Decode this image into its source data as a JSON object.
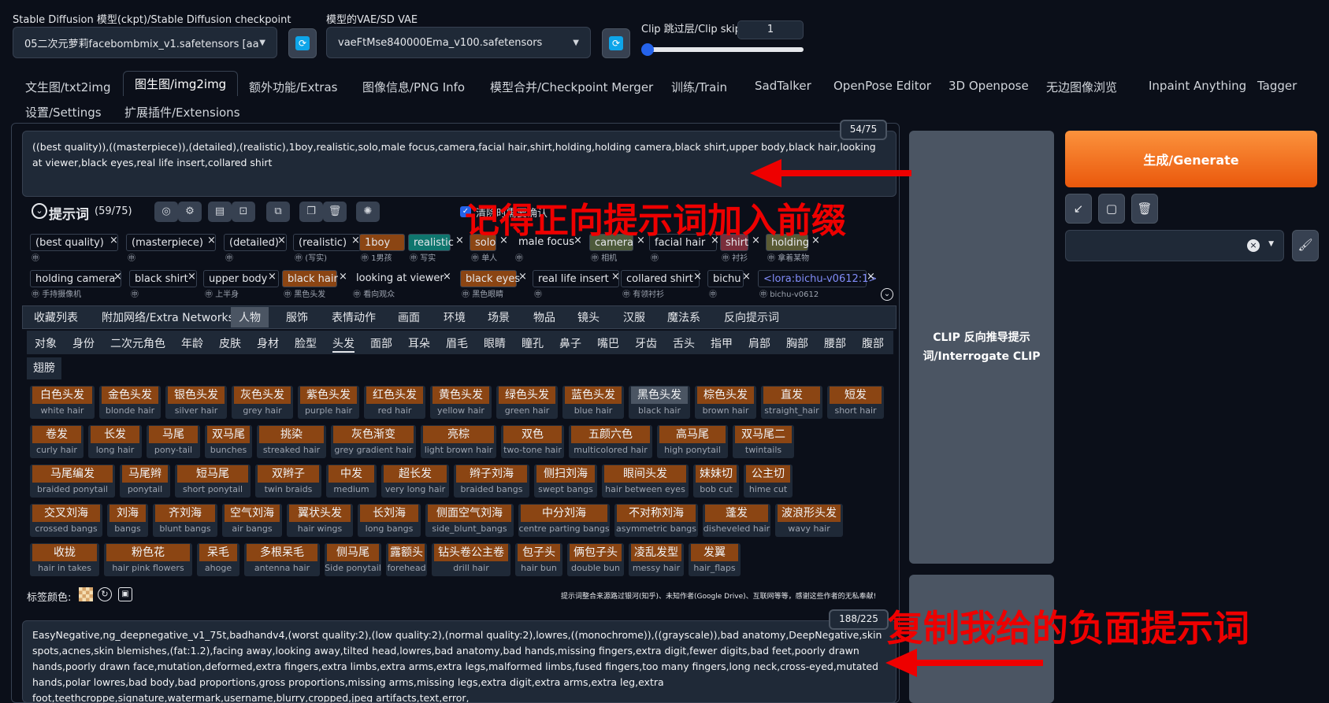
{
  "top": {
    "ckpt_label": "Stable Diffusion 模型(ckpt)/Stable Diffusion checkpoint",
    "ckpt_value": "05二次元萝莉facebombmix_v1.safetensors [aa",
    "vae_label": "模型的VAE/SD VAE",
    "vae_value": "vaeFtMse840000Ema_v100.safetensors",
    "clip_label": "Clip 跳过层/Clip skip",
    "clip_value": "1",
    "slider_fraction": 0.0
  },
  "tabs": [
    "文生图/txt2img",
    "图生图/img2img",
    "额外功能/Extras",
    "图像信息/PNG Info",
    "模型合并/Checkpoint Merger",
    "训练/Train",
    "SadTalker",
    "OpenPose Editor",
    "3D Openpose",
    "无边图像浏览",
    "Inpaint Anything",
    "Tagger",
    "设置/Settings",
    "扩展插件/Extensions"
  ],
  "prompt": {
    "counter": "54/75",
    "text": "((best quality)),((masterpiece)),(detailed),(realistic),1boy,realistic,solo,male focus,camera,facial hair,shirt,holding,holding camera,black shirt,upper body,black hair,looking at viewer,black eyes,real life insert,collared shirt",
    "helper_title": "提示词",
    "helper_count": "(59/75)",
    "checkbox_label": "清除时需要确认"
  },
  "chips_row1": [
    {
      "t": "(best quality)",
      "s": ""
    },
    {
      "t": "(masterpiece)",
      "s": ""
    },
    {
      "t": "(detailed)",
      "s": ""
    },
    {
      "t": "(realistic)",
      "s": "(写实)"
    },
    {
      "t": "1boy",
      "s": "1男孩"
    },
    {
      "t": "realistic",
      "s": "写实"
    },
    {
      "t": "solo",
      "s": "单人"
    },
    {
      "t": "male focus",
      "s": ""
    },
    {
      "t": "camera",
      "s": "相机"
    },
    {
      "t": "facial hair",
      "s": ""
    },
    {
      "t": "shirt",
      "s": "衬衫"
    },
    {
      "t": "holding",
      "s": "拿着某物"
    }
  ],
  "chips_row2": [
    {
      "t": "holding camera",
      "s": "手持摄像机"
    },
    {
      "t": "black shirt",
      "s": ""
    },
    {
      "t": "upper body",
      "s": "上半身"
    },
    {
      "t": "black hair",
      "s": "黑色头发"
    },
    {
      "t": "looking at viewer",
      "s": "看向观众"
    },
    {
      "t": "black eyes",
      "s": "黑色眼睛"
    },
    {
      "t": "real life insert",
      "s": ""
    },
    {
      "t": "collared shirt",
      "s": "有领衬衫"
    },
    {
      "t": "bichu",
      "s": ""
    },
    {
      "t": "<lora:bichu-v0612:1>",
      "s": "bichu-v0612"
    }
  ],
  "categories": [
    "收藏列表",
    "附加网络/Extra Networks",
    "人物",
    "服饰",
    "表情动作",
    "画面",
    "环境",
    "场景",
    "物品",
    "镜头",
    "汉服",
    "魔法系",
    "反向提示词"
  ],
  "subcategories": [
    "对象",
    "身份",
    "二次元角色",
    "年龄",
    "皮肤",
    "身材",
    "脸型",
    "头发",
    "面部",
    "耳朵",
    "眉毛",
    "眼睛",
    "瞳孔",
    "鼻子",
    "嘴巴",
    "牙齿",
    "舌头",
    "指甲",
    "肩部",
    "胸部",
    "腰部",
    "腹部",
    "翅膀"
  ],
  "tag_rows": [
    [
      [
        "白色头发",
        "white hair"
      ],
      [
        "金色头发",
        "blonde hair"
      ],
      [
        "银色头发",
        "silver hair"
      ],
      [
        "灰色头发",
        "grey hair"
      ],
      [
        "紫色头发",
        "purple hair"
      ],
      [
        "红色头发",
        "red hair"
      ],
      [
        "黄色头发",
        "yellow hair"
      ],
      [
        "绿色头发",
        "green hair"
      ],
      [
        "蓝色头发",
        "blue hair"
      ],
      [
        "黑色头发",
        "black hair"
      ],
      [
        "棕色头发",
        "brown hair"
      ],
      [
        "直发",
        "straight_hair"
      ],
      [
        "短发",
        "short hair"
      ]
    ],
    [
      [
        "卷发",
        "curly hair"
      ],
      [
        "长发",
        "long hair"
      ],
      [
        "马尾",
        "pony-tail"
      ],
      [
        "双马尾",
        "bunches"
      ],
      [
        "挑染",
        "streaked hair"
      ],
      [
        "灰色渐变",
        "grey gradient hair"
      ],
      [
        "亮棕",
        "light brown hair"
      ],
      [
        "双色",
        "two-tone hair"
      ],
      [
        "五颜六色",
        "multicolored hair"
      ],
      [
        "高马尾",
        "high ponytail"
      ],
      [
        "双马尾二",
        "twintails"
      ]
    ],
    [
      [
        "马尾编发",
        "braided ponytail"
      ],
      [
        "马尾辫",
        "ponytail"
      ],
      [
        "短马尾",
        "short ponytail"
      ],
      [
        "双辫子",
        "twin braids"
      ],
      [
        "中发",
        "medium hair"
      ],
      [
        "超长发",
        "very long hair"
      ],
      [
        "辫子刘海",
        "braided bangs"
      ],
      [
        "侧扫刘海",
        "swept bangs"
      ],
      [
        "眼间头发",
        "hair between eyes"
      ],
      [
        "妹妹切",
        "bob cut"
      ],
      [
        "公主切",
        "hime cut"
      ]
    ],
    [
      [
        "交叉刘海",
        "crossed bangs"
      ],
      [
        "刘海",
        "bangs"
      ],
      [
        "齐刘海",
        "blunt bangs"
      ],
      [
        "空气刘海",
        "air bangs"
      ],
      [
        "翼状头发",
        "hair wings"
      ],
      [
        "长刘海",
        "long bangs"
      ],
      [
        "侧面空气刘海",
        "side_blunt_bangs"
      ],
      [
        "中分刘海",
        "centre parting bangs"
      ],
      [
        "不对称刘海",
        "asymmetric bangs"
      ],
      [
        "蓬发",
        "disheveled hair"
      ],
      [
        "波浪形头发",
        "wavy hair"
      ]
    ],
    [
      [
        "收拢",
        "hair in takes"
      ],
      [
        "粉色花",
        "hair pink flowers"
      ],
      [
        "呆毛",
        "ahoge"
      ],
      [
        "多根呆毛",
        "antenna hair"
      ],
      [
        "侧马尾",
        "Side ponytail"
      ],
      [
        "露额头",
        "forehead"
      ],
      [
        "钻头卷公主卷",
        "drill hair"
      ],
      [
        "包子头",
        "hair bun"
      ],
      [
        "俩包子头",
        "double bun"
      ],
      [
        "凌乱发型",
        "messy hair"
      ],
      [
        "发翼",
        "hair_flaps"
      ]
    ]
  ],
  "tag_color_label": "标签颜色:",
  "credits": "提示词整合来源路过银河(知乎)、未知作者(Google Drive)、互联网等等，感谢这些作者的无私奉献!",
  "negative": {
    "counter": "188/225",
    "text": "EasyNegative,ng_deepnegative_v1_75t,badhandv4,(worst quality:2),(low quality:2),(normal quality:2),lowres,((monochrome)),((grayscale)),bad anatomy,DeepNegative,skin spots,acnes,skin blemishes,(fat:1.2),facing away,looking away,tilted head,lowres,bad anatomy,bad hands,missing fingers,extra digit,fewer digits,bad feet,poorly drawn hands,poorly drawn face,mutation,deformed,extra fingers,extra limbs,extra arms,extra legs,malformed limbs,fused fingers,too many fingers,long neck,cross-eyed,mutated hands,polar lowres,bad body,bad proportions,gross proportions,missing arms,missing legs,extra digit,extra arms,extra leg,extra foot,teethcroppe,signature,watermark,username,blurry,cropped,jpeg artifacts,text,error,"
  },
  "right": {
    "clip_button": "CLIP 反向推导提示词/Interrogate CLIP",
    "generate": "生成/Generate"
  },
  "annotations": {
    "a1": "记得正向提示词加入前缀",
    "a2": "复制我给的负面提示词"
  },
  "colors": {
    "accent": "#f97316",
    "annotation": "#ee0000",
    "tag_bg": "#8b4513"
  }
}
